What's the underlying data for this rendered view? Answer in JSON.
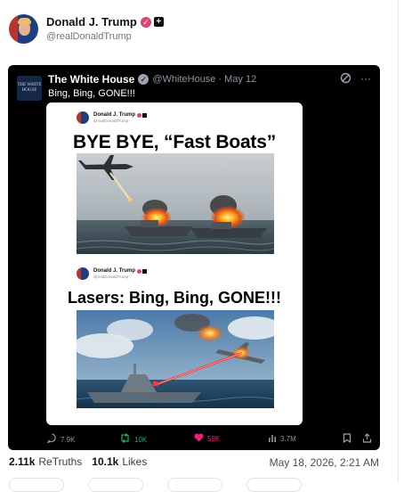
{
  "post": {
    "author_name": "Donald J. Trump",
    "author_handle": "@realDonaldTrump"
  },
  "embed": {
    "author_name": "The White House",
    "author_handle": "@WhiteHouse",
    "separator": "·",
    "date": "May 12",
    "text": "Bing, Bing, GONE!!!",
    "avatar_text": "THE WHITE HOUSE",
    "card": {
      "mini_name": "Donald J. Trump",
      "mini_handle": "@realDonaldTrump",
      "title_1": "BYE BYE, “Fast Boats”",
      "title_2": "Lasers: Bing, Bing, GONE!!!"
    },
    "actions": {
      "replies": "7.9K",
      "retruths": "10K",
      "likes": "59K",
      "views": "3.7M"
    }
  },
  "stats": {
    "retruths_count": "2.11k",
    "retruths_label": "ReTruths",
    "likes_count": "10.1k",
    "likes_label": "Likes",
    "timestamp": "May 18, 2026, 2:21 AM"
  },
  "colors": {
    "verified_badge": "#e0436d",
    "retruth_green": "#17b26a",
    "like_pink": "#f01e7a",
    "embed_bg": "#000000",
    "muted_text": "#8b949e"
  },
  "icons": {
    "reply": "reply-icon",
    "retruth": "retruth-icon",
    "like": "heart-icon",
    "views": "views-icon",
    "bookmark": "bookmark-icon",
    "share": "share-icon"
  }
}
